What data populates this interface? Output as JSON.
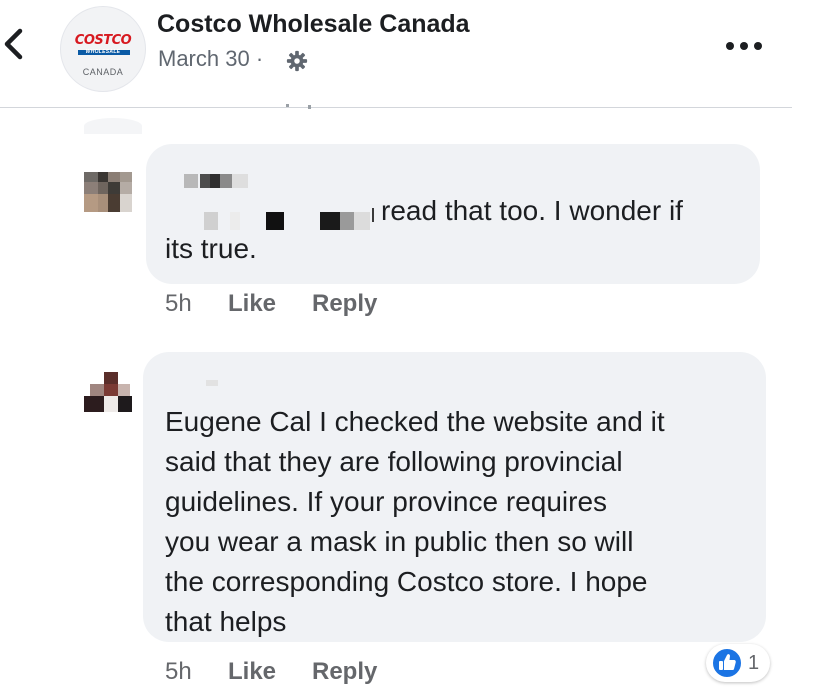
{
  "header": {
    "page_name": "Costco Wholesale Canada",
    "post_date": "March 30 ·",
    "logo": {
      "word": "COSTCO",
      "sub": "WHOLESALE",
      "country": "CANADA"
    },
    "icons": {
      "back": "chevron-left-icon",
      "privacy": "gear-icon",
      "more": "more-options-icon"
    }
  },
  "comments": [
    {
      "author_redacted": true,
      "text_lines": [
        "read that too. I wonder if",
        "its true."
      ],
      "time": "5h",
      "like_label": "Like",
      "reply_label": "Reply"
    },
    {
      "author_redacted": true,
      "text_lines": [
        "Eugene Cal I checked the website and it",
        "said that they are following provincial",
        "guidelines.  If your province requires",
        "you wear a mask in public then so will",
        "the corresponding Costco store.  I hope",
        "that helps"
      ],
      "time": "5h",
      "like_label": "Like",
      "reply_label": "Reply",
      "reaction": {
        "icon": "thumbs-up-icon",
        "count": "1"
      }
    }
  ],
  "colors": {
    "bubble": "#f0f2f5",
    "secondary_text": "#65676b",
    "accent_blue": "#1b74e4",
    "costco_red": "#d71920",
    "costco_blue": "#0a5aa5"
  }
}
